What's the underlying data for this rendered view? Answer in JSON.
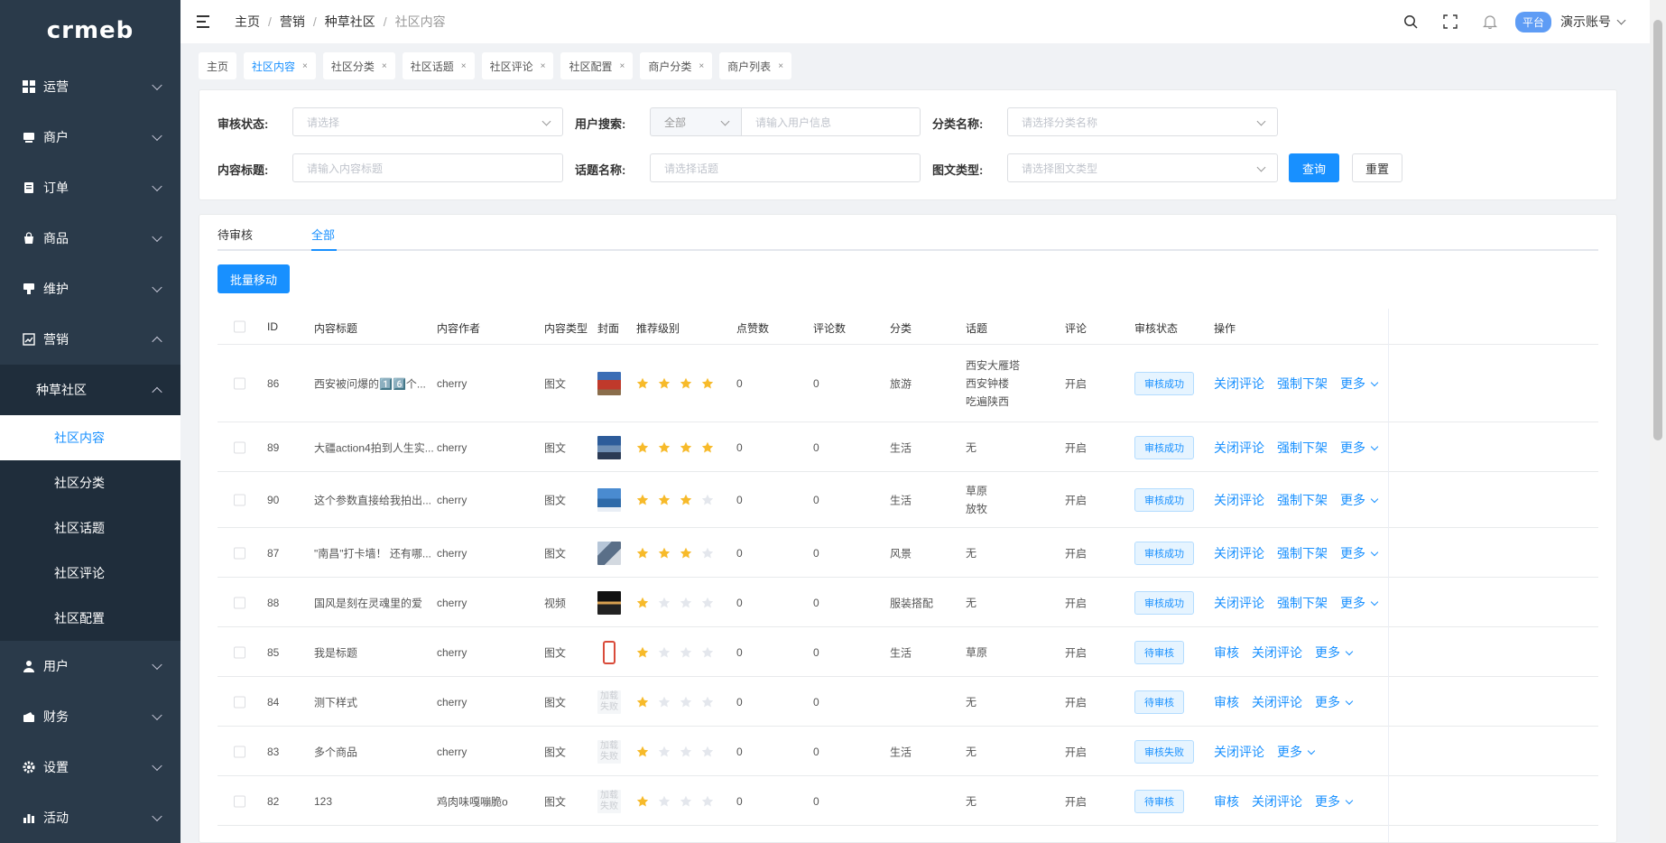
{
  "logo": "crmeb",
  "sidebar": {
    "items": [
      {
        "label": "运营",
        "icon": "grid-icon"
      },
      {
        "label": "商户",
        "icon": "shop-icon"
      },
      {
        "label": "订单",
        "icon": "order-icon"
      },
      {
        "label": "商品",
        "icon": "bag-icon"
      },
      {
        "label": "维护",
        "icon": "maintenance-icon"
      },
      {
        "label": "营销",
        "icon": "chart-icon"
      }
    ],
    "sub_group": "种草社区",
    "sub_items": [
      "社区内容",
      "社区分类",
      "社区话题",
      "社区评论",
      "社区配置"
    ],
    "items_after": [
      {
        "label": "用户",
        "icon": "user-icon"
      },
      {
        "label": "财务",
        "icon": "finance-icon"
      },
      {
        "label": "设置",
        "icon": "gear-icon"
      },
      {
        "label": "活动",
        "icon": "activity-icon"
      }
    ]
  },
  "header": {
    "breadcrumb": [
      "主页",
      "营销",
      "种草社区",
      "社区内容"
    ],
    "platform_badge": "平台",
    "account": "演示账号"
  },
  "tags": [
    {
      "label": "主页",
      "closable": false,
      "active": false
    },
    {
      "label": "社区内容",
      "closable": true,
      "active": true
    },
    {
      "label": "社区分类",
      "closable": true,
      "active": false
    },
    {
      "label": "社区话题",
      "closable": true,
      "active": false
    },
    {
      "label": "社区评论",
      "closable": true,
      "active": false
    },
    {
      "label": "社区配置",
      "closable": true,
      "active": false
    },
    {
      "label": "商户分类",
      "closable": true,
      "active": false
    },
    {
      "label": "商户列表",
      "closable": true,
      "active": false
    }
  ],
  "filters": {
    "audit_status": {
      "label": "审核状态:",
      "placeholder": "请选择"
    },
    "user_search": {
      "label": "用户搜索:",
      "type_value": "全部",
      "placeholder": "请输入用户信息"
    },
    "category": {
      "label": "分类名称:",
      "placeholder": "请选择分类名称"
    },
    "content_title": {
      "label": "内容标题:",
      "placeholder": "请输入内容标题"
    },
    "topic": {
      "label": "话题名称:",
      "placeholder": "请选择话题"
    },
    "media_type": {
      "label": "图文类型:",
      "placeholder": "请选择图文类型"
    },
    "query_btn": "查询",
    "reset_btn": "重置"
  },
  "tabs": [
    "待审核",
    "全部"
  ],
  "batch_move": "批量移动",
  "table": {
    "columns": [
      "ID",
      "内容标题",
      "内容作者",
      "内容类型",
      "封面",
      "推荐级别",
      "点赞数",
      "评论数",
      "分类",
      "话题",
      "评论",
      "审核状态",
      "操作"
    ],
    "rows": [
      {
        "id": "86",
        "title": "西安被问爆的1️⃣6️⃣个...",
        "author": "cherry",
        "type": "图文",
        "cover": "photo-red",
        "stars": 4,
        "likes": "0",
        "comments": "0",
        "category": "旅游",
        "topics": [
          "西安大雁塔",
          "西安钟楼",
          "吃遍陕西"
        ],
        "comment": "开启",
        "status": "审核成功",
        "ops": [
          "关闭评论",
          "强制下架"
        ],
        "more": "更多"
      },
      {
        "id": "89",
        "title": "大疆action4拍到人生实...",
        "author": "cherry",
        "type": "图文",
        "cover": "photo-sky",
        "stars": 4,
        "likes": "0",
        "comments": "0",
        "category": "生活",
        "topics": [
          "无"
        ],
        "comment": "开启",
        "status": "审核成功",
        "ops": [
          "关闭评论",
          "强制下架"
        ],
        "more": "更多"
      },
      {
        "id": "90",
        "title": "这个参数直接给我拍出...",
        "author": "cherry",
        "type": "图文",
        "cover": "photo-blue",
        "stars": 3,
        "likes": "0",
        "comments": "0",
        "category": "生活",
        "topics": [
          "草原",
          "放牧"
        ],
        "comment": "开启",
        "status": "审核成功",
        "ops": [
          "关闭评论",
          "强制下架"
        ],
        "more": "更多"
      },
      {
        "id": "87",
        "title": "\"南昌\"打卡墙！ 还有哪...",
        "author": "cherry",
        "type": "图文",
        "cover": "photo-wall",
        "stars": 3,
        "likes": "0",
        "comments": "0",
        "category": "风景",
        "topics": [
          "无"
        ],
        "comment": "开启",
        "status": "审核成功",
        "ops": [
          "关闭评论",
          "强制下架"
        ],
        "more": "更多"
      },
      {
        "id": "88",
        "title": "国风是刻在灵魂里的爱",
        "author": "cherry",
        "type": "视频",
        "cover": "photo-dark",
        "stars": 1,
        "likes": "0",
        "comments": "0",
        "category": "服装搭配",
        "topics": [
          "无"
        ],
        "comment": "开启",
        "status": "审核成功",
        "ops": [
          "关闭评论",
          "强制下架"
        ],
        "more": "更多"
      },
      {
        "id": "85",
        "title": "我是标题",
        "author": "cherry",
        "type": "图文",
        "cover": "photo-phone",
        "stars": 1,
        "likes": "0",
        "comments": "0",
        "category": "生活",
        "topics": [
          "草原"
        ],
        "comment": "开启",
        "status": "待审核",
        "ops": [
          "审核",
          "关闭评论"
        ],
        "more": "更多"
      },
      {
        "id": "84",
        "title": "测下样式",
        "author": "cherry",
        "type": "图文",
        "cover": "placeholder",
        "cover_text": "加载失败",
        "stars": 1,
        "likes": "0",
        "comments": "0",
        "category": "",
        "topics": [
          "无"
        ],
        "comment": "开启",
        "status": "待审核",
        "ops": [
          "审核",
          "关闭评论"
        ],
        "more": "更多"
      },
      {
        "id": "83",
        "title": "多个商品",
        "author": "cherry",
        "type": "图文",
        "cover": "placeholder",
        "cover_text": "加载失败",
        "stars": 1,
        "likes": "0",
        "comments": "0",
        "category": "生活",
        "topics": [
          "无"
        ],
        "comment": "开启",
        "status": "审核失败",
        "ops": [
          "关闭评论"
        ],
        "more": "更多"
      },
      {
        "id": "82",
        "title": "123",
        "author": "鸡肉味嘎嘣脆o",
        "type": "图文",
        "cover": "placeholder",
        "cover_text": "加载失败",
        "stars": 1,
        "likes": "0",
        "comments": "0",
        "category": "",
        "topics": [
          "无"
        ],
        "comment": "开启",
        "status": "待审核",
        "ops": [
          "审核",
          "关闭评论"
        ],
        "more": "更多"
      }
    ]
  },
  "colors": {
    "accent": "#1890ff",
    "sidebar_bg": "#2a3a4a",
    "star_on": "#f7ba2a",
    "star_off": "#e4e7ed"
  }
}
